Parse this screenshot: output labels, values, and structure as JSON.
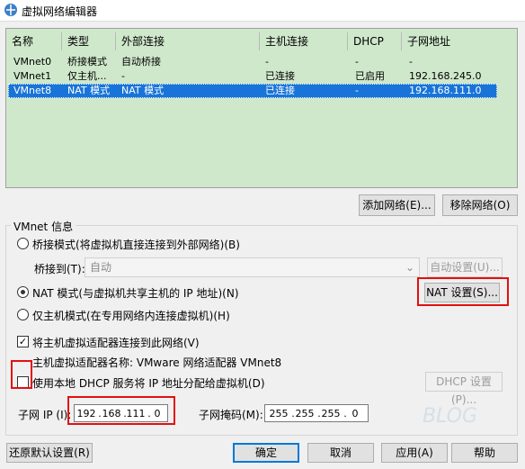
{
  "window": {
    "title": "虚拟网络编辑器"
  },
  "table": {
    "headers": [
      "名称",
      "类型",
      "外部连接",
      "主机连接",
      "DHCP",
      "子网地址"
    ],
    "rows": [
      [
        "VMnet0",
        "桥接模式",
        "自动桥接",
        "-",
        "-",
        "-"
      ],
      [
        "VMnet1",
        "仅主机...",
        "-",
        "已连接",
        "已启用",
        "192.168.245.0"
      ],
      [
        "VMnet8",
        "NAT 模式",
        "NAT 模式",
        "已连接",
        "-",
        "192.168.111.0"
      ]
    ],
    "selected_row": 2
  },
  "buttons": {
    "add_network": "添加网络(E)...",
    "remove_network": "移除网络(O)",
    "auto_settings": "自动设置(U)...",
    "nat_settings": "NAT 设置(S)...",
    "dhcp_settings": "DHCP 设置(P)...",
    "restore_defaults": "还原默认设置(R)",
    "ok": "确定",
    "cancel": "取消",
    "apply": "应用(A)",
    "help": "帮助"
  },
  "vmnet_info": {
    "group_label": "VMnet 信息",
    "bridged_label": "桥接模式(将虚拟机直接连接到外部网络)(B)",
    "bridge_to_label": "桥接到(T):",
    "bridge_to_value": "自动",
    "nat_label": "NAT 模式(与虚拟机共享主机的 IP 地址)(N)",
    "hostonly_label": "仅主机模式(在专用网络内连接虚拟机)(H)",
    "selected_mode": "nat",
    "connect_adapter_label": "将主机虚拟适配器连接到此网络(V)",
    "connect_adapter_checked": true,
    "adapter_name_label": "主机虚拟适配器名称: VMware 网络适配器 VMnet8",
    "use_dhcp_label": "使用本地 DHCP 服务将 IP 地址分配给虚拟机(D)",
    "use_dhcp_checked": false,
    "subnet_ip_label": "子网 IP (I):",
    "subnet_ip": [
      "192",
      "168",
      "111",
      "0"
    ],
    "subnet_mask_label": "子网掩码(M):",
    "subnet_mask": [
      "255",
      "255",
      "255",
      "0"
    ]
  },
  "watermark": "BLOG"
}
